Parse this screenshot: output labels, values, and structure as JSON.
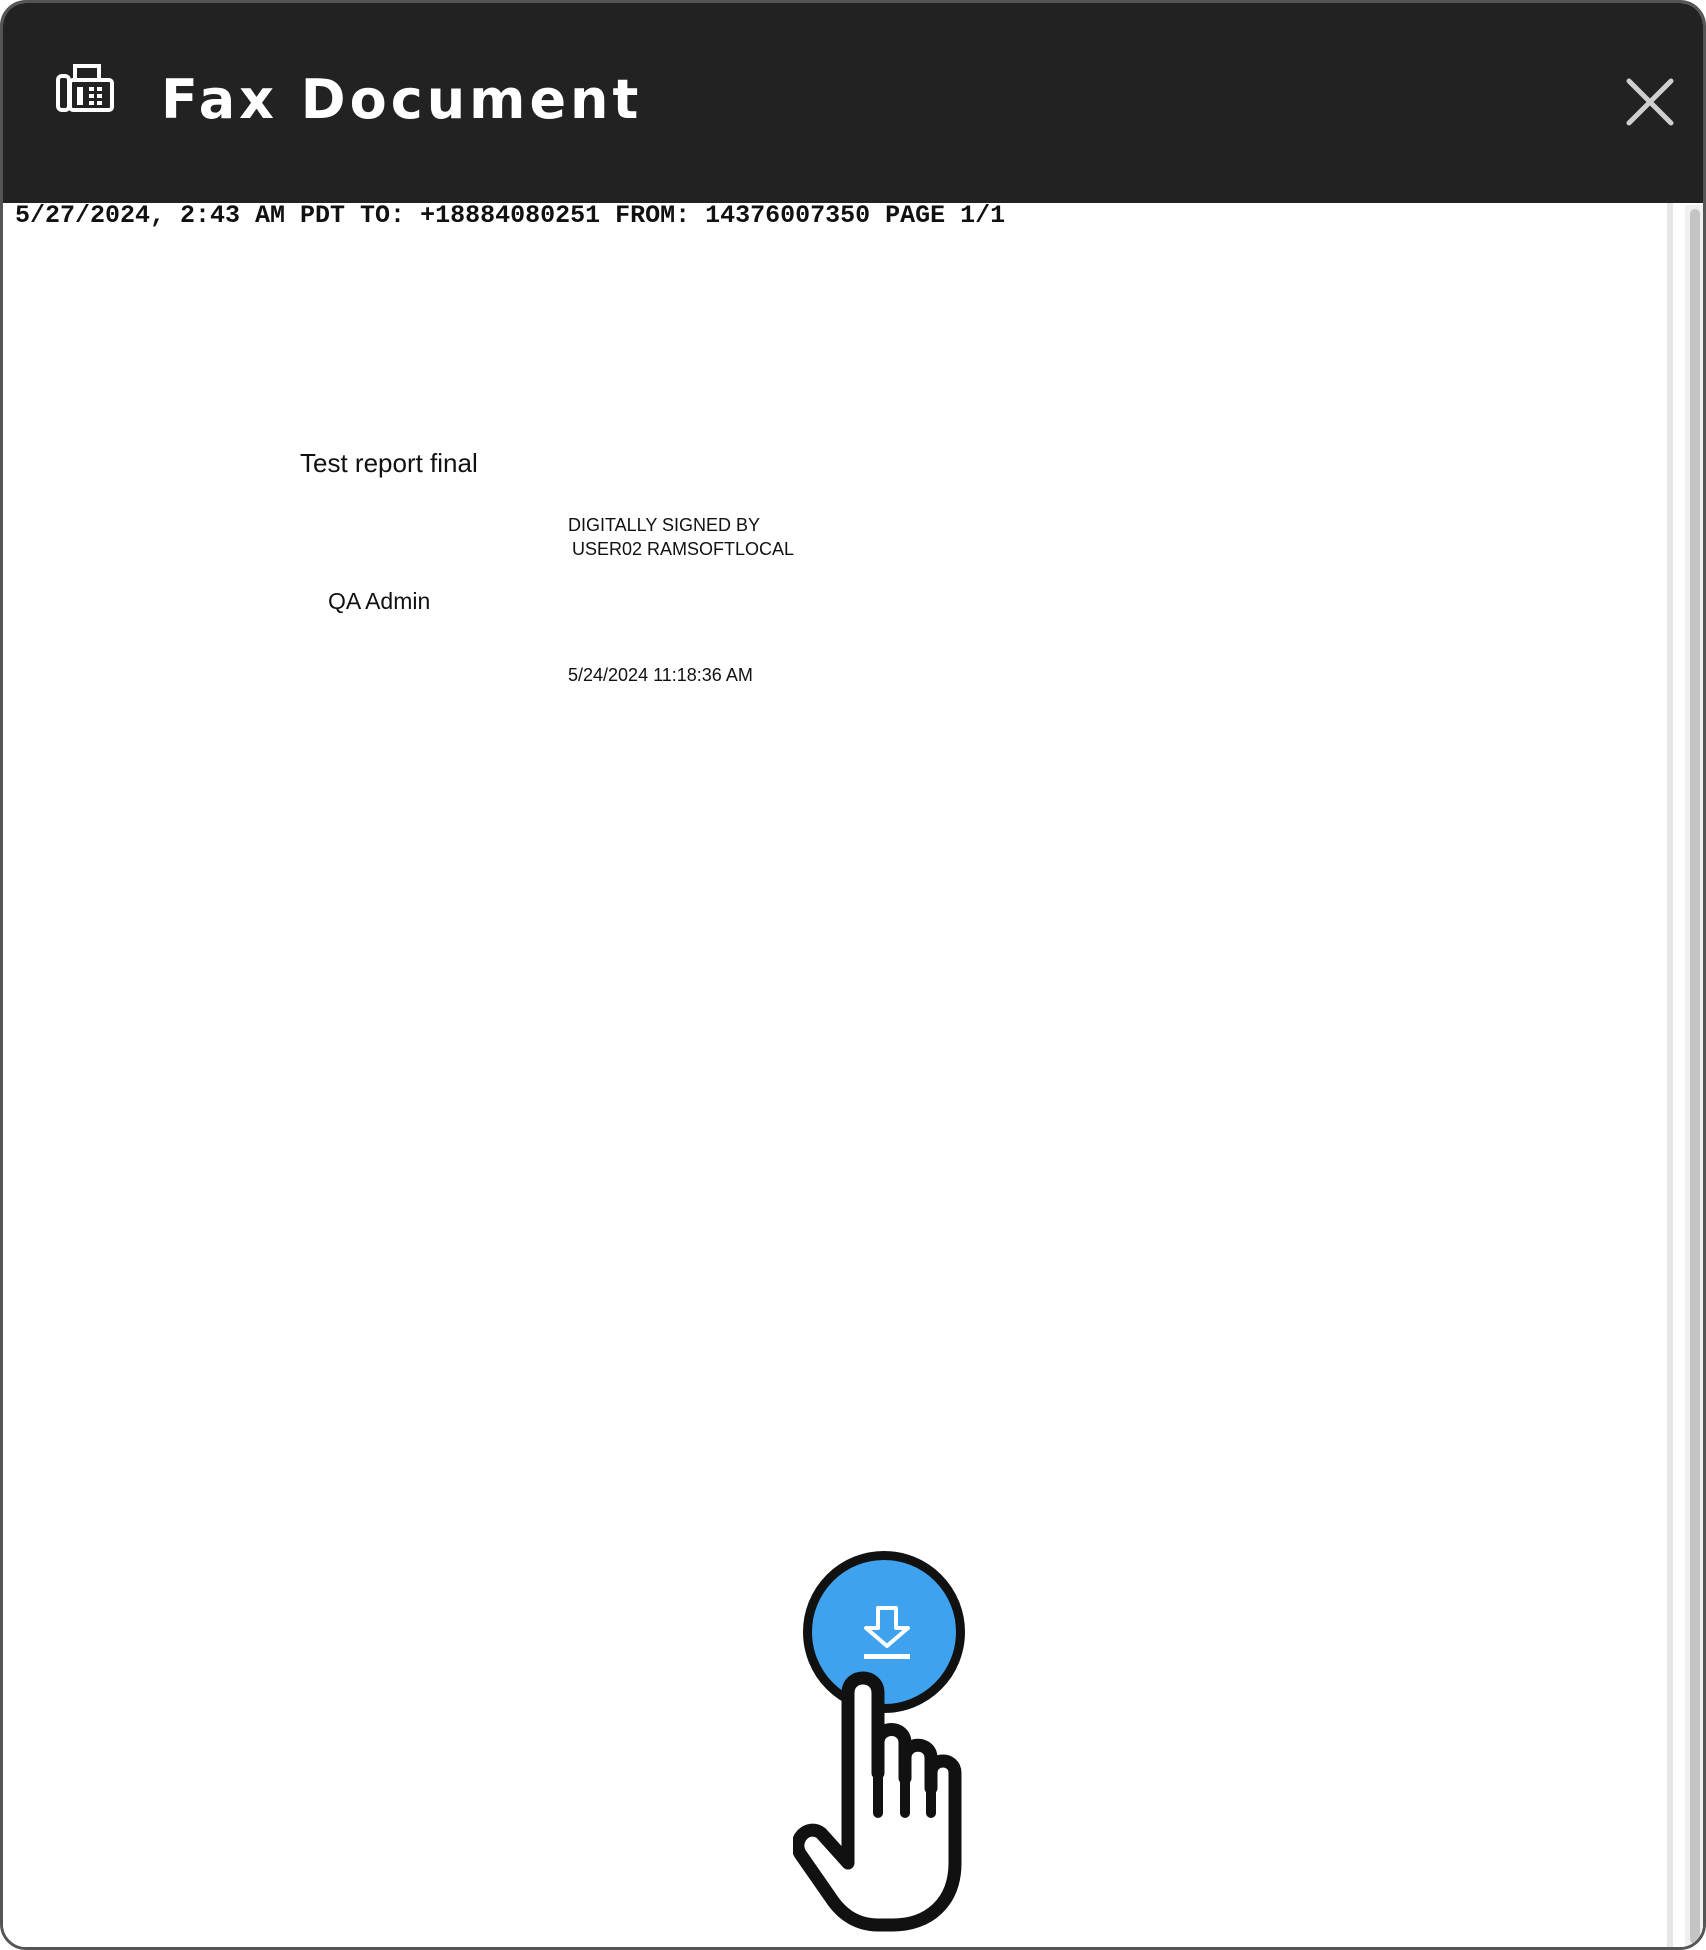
{
  "dialog": {
    "title": "Fax Document",
    "icons": {
      "fax": "fax-icon",
      "close": "close-icon",
      "download": "download-icon",
      "pointer": "hand-pointer-icon"
    },
    "colors": {
      "titlebar": "#222222",
      "accent": "#3ea2ee"
    }
  },
  "fax": {
    "header_line": "5/27/2024, 2:43 AM PDT TO: +18884080251 FROM: 14376007350 PAGE 1/1",
    "document_title": "Test report final",
    "signed_by_line1": "DIGITALLY SIGNED BY",
    "signed_by_line2": "USER02 RAMSOFTLOCAL",
    "signer_name": "QA Admin",
    "signed_date": "5/24/2024 11:18:36 AM"
  }
}
